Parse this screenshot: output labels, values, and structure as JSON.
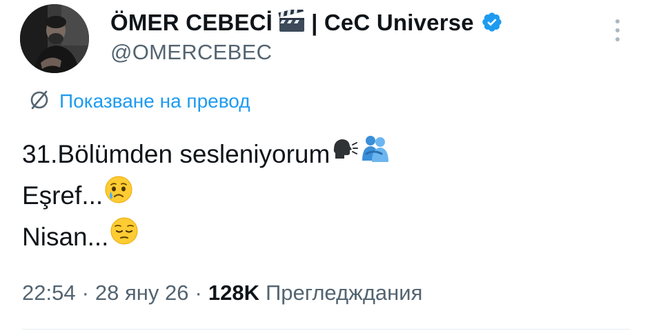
{
  "author": {
    "display_name": "ÖMER CEBECİ",
    "name_suffix": "| CeC Universe",
    "handle": "@OMERCEBEC",
    "verified": true,
    "badge_icon": "clapper-board-icon",
    "verified_icon": "verified-badge-icon"
  },
  "translate": {
    "label": "Показване на превод",
    "icon": "translate-icon"
  },
  "tweet": {
    "lines": [
      {
        "text": "31.Bölümden sesleniyorum",
        "emojis": [
          "speaking-head-icon",
          "hugging-people-icon"
        ]
      },
      {
        "text": "Eşref...",
        "emojis": [
          "crying-face-icon"
        ]
      },
      {
        "text": "Nisan...",
        "emojis": [
          "pensive-face-icon"
        ]
      }
    ]
  },
  "meta": {
    "time": "22:54",
    "separator": "·",
    "date": "28 яну 26",
    "views_count": "128K",
    "views_label": "Прегледждания"
  },
  "colors": {
    "accent": "#1d9bf0",
    "text_primary": "#0f1419",
    "text_secondary": "#536471",
    "verified": "#1d9bf0"
  }
}
